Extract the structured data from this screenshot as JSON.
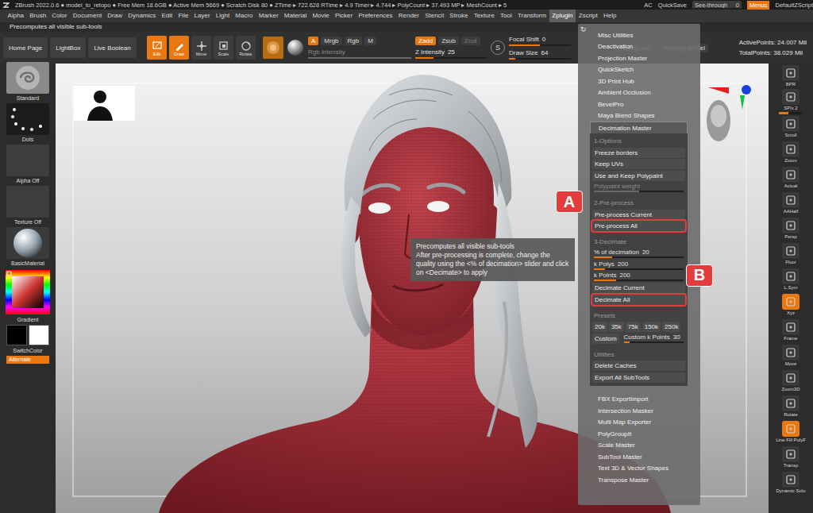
{
  "title_bar": {
    "info": "ZBrush 2022.0.6 ● model_to_retopo ● Free Mem 18.6GB ● Active Mem 5669 ● Scratch Disk 80 ● ZTime ▸ 722.628 RTime ▸ 4.9 Timer ▸ 4.744 ▸ PolyCount ▸ 37.493 MP ▸ MeshCount ▸ 5",
    "ac": "AC",
    "quicksave": "QuickSave",
    "see_through": {
      "label": "See-through",
      "value": "0",
      "level": 0
    },
    "menus": {
      "label": "Menus",
      "on": true
    },
    "script": "DefaultZScript"
  },
  "menu_bar": [
    {
      "label": "Alpha",
      "selected": false
    },
    {
      "label": "Brush",
      "selected": false
    },
    {
      "label": "Color",
      "selected": false
    },
    {
      "label": "Document",
      "selected": false
    },
    {
      "label": "Draw",
      "selected": false
    },
    {
      "label": "Dynamics",
      "selected": false
    },
    {
      "label": "Edit",
      "selected": false
    },
    {
      "label": "File",
      "selected": false
    },
    {
      "label": "Layer",
      "selected": false
    },
    {
      "label": "Light",
      "selected": false
    },
    {
      "label": "Macro",
      "selected": false
    },
    {
      "label": "Marker",
      "selected": false
    },
    {
      "label": "Material",
      "selected": false
    },
    {
      "label": "Movie",
      "selected": false
    },
    {
      "label": "Picker",
      "selected": false
    },
    {
      "label": "Preferences",
      "selected": false
    },
    {
      "label": "Render",
      "selected": false
    },
    {
      "label": "Stencil",
      "selected": false
    },
    {
      "label": "Stroke",
      "selected": false
    },
    {
      "label": "Texture",
      "selected": false
    },
    {
      "label": "Tool",
      "selected": false
    },
    {
      "label": "Transform",
      "selected": false
    },
    {
      "label": "Zplugin",
      "selected": true
    },
    {
      "label": "Zscript",
      "selected": false
    },
    {
      "label": "Help",
      "selected": false
    }
  ],
  "status": "Precomputes all visible sub-tools",
  "toolbar": {
    "nav": [
      {
        "label": "Home Page"
      },
      {
        "label": "LightBox"
      },
      {
        "label": "Live Boolean"
      }
    ],
    "modes": [
      {
        "label": "Edit",
        "on": true
      },
      {
        "label": "Draw",
        "on": true
      },
      {
        "label": "Move",
        "on": false
      },
      {
        "label": "Scale",
        "on": false
      },
      {
        "label": "Rotate",
        "on": false
      }
    ],
    "color_modes": [
      {
        "label": "A",
        "on": true
      },
      {
        "label": "Mrgb",
        "on": false
      },
      {
        "label": "Rgb",
        "on": false
      },
      {
        "label": "M",
        "on": false
      }
    ],
    "rgb_intensity": {
      "label": "Rgb Intensity",
      "level": 1,
      "disabled": true
    },
    "z_modes": [
      {
        "label": "Zadd",
        "on": true,
        "disabled": false
      },
      {
        "label": "Zsub",
        "on": false,
        "disabled": false
      },
      {
        "label": "Zcut",
        "on": false,
        "disabled": true
      }
    ],
    "z_intensity": {
      "label": "Z Intensity",
      "value": "25",
      "level": 0.25,
      "disabled": false
    },
    "stroke_icon": "S",
    "focal_shift": {
      "label": "Focal Shift",
      "value": "0",
      "level": 0.5,
      "disabled": false
    },
    "draw_size": {
      "label": "Draw Size",
      "value": "64",
      "level": 0.1,
      "disabled": false
    },
    "replay": [
      "ReplayLast",
      "ReplayLastRel"
    ],
    "points": [
      "ActivePoints: 24.007 Mil",
      "TotalPoints: 38.029 Mil"
    ]
  },
  "left_shelf": {
    "items": [
      {
        "label": "Standard",
        "kind": "brush"
      },
      {
        "label": "Dots",
        "kind": "stroke"
      },
      {
        "label": "Alpha Off",
        "kind": "alpha"
      },
      {
        "label": "Texture Off",
        "kind": "texture"
      },
      {
        "label": "BasicMaterial",
        "kind": "material"
      }
    ],
    "gradient": "Gradient",
    "main_color": "#000000",
    "secondary_color": "#ffffff",
    "switch_color": "SwitchColor",
    "alternate": {
      "label": "Alternate",
      "on": true
    }
  },
  "right_shelf": [
    {
      "label": "BPR",
      "kind": "icon",
      "on": false
    },
    {
      "label": "SPix 2",
      "kind": "slider",
      "on": false,
      "level": 0.4
    },
    {
      "label": "Scroll",
      "kind": "icon",
      "on": false
    },
    {
      "label": "Zoom",
      "kind": "icon",
      "on": false
    },
    {
      "label": "Actual",
      "kind": "icon",
      "on": false
    },
    {
      "label": "AAHalf",
      "kind": "icon",
      "on": false
    },
    {
      "label": "Persp",
      "kind": "icon",
      "on": false
    },
    {
      "label": "Floor",
      "kind": "icon",
      "on": false
    },
    {
      "label": "L.Sym",
      "kind": "icon",
      "on": false
    },
    {
      "label": "Xyz",
      "kind": "icon",
      "on": true
    },
    {
      "label": "Frame",
      "kind": "icon",
      "on": false
    },
    {
      "label": "Move",
      "kind": "icon",
      "on": false
    },
    {
      "label": "Zoom3D",
      "kind": "icon",
      "on": false
    },
    {
      "label": "Rotate",
      "kind": "icon",
      "on": false
    },
    {
      "label": "Line Fill PolyF",
      "kind": "icon",
      "on": true
    },
    {
      "label": "Transp",
      "kind": "icon",
      "on": false
    },
    {
      "label": "Dynamic Solo",
      "kind": "icon",
      "on": false
    }
  ],
  "zplugin_menu": {
    "top_icon": "↻",
    "items_before": [
      "Misc Utilities",
      "Deactivation",
      "Projection Master",
      "QuickSketch",
      "3D Print Hub",
      "Ambient Occlusion",
      "BevelPro",
      "Maya Blend Shapes"
    ],
    "decimation": {
      "title": "Decimation Master",
      "expanded": true,
      "sections": [
        {
          "heading": "1-Options",
          "rows": [
            {
              "kind": "button",
              "label": "Freeze borders"
            },
            {
              "kind": "button",
              "label": "Keep UVs"
            },
            {
              "kind": "button",
              "label": "Use and Keep Polypaint"
            },
            {
              "kind": "slider",
              "label": "Polypaint weight",
              "level": 0.5,
              "disabled": true
            }
          ]
        },
        {
          "heading": "2-Pre-process",
          "rows": [
            {
              "kind": "button",
              "label": "Pre-process Current"
            },
            {
              "kind": "button",
              "label": "Pre-process All",
              "callout": "A"
            }
          ]
        },
        {
          "heading": "3-Decimate",
          "rows": [
            {
              "kind": "slider",
              "label": "% of decimation",
              "value": "20",
              "level": 0.2,
              "disabled": false
            },
            {
              "kind": "slider",
              "label": "k Polys",
              "value": "200",
              "level": 0.12,
              "disabled": false
            },
            {
              "kind": "slider",
              "label": "k Points",
              "value": "200",
              "level": 0.25,
              "disabled": false
            },
            {
              "kind": "button",
              "label": "Decimate Current"
            },
            {
              "kind": "button",
              "label": "Decimate All",
              "callout": "B"
            }
          ]
        },
        {
          "heading": "Presets",
          "rows": [
            {
              "kind": "presets",
              "options": [
                "20k",
                "35k",
                "75k",
                "150k",
                "250k"
              ]
            },
            {
              "kind": "custom",
              "button": "Custom",
              "slider": {
                "label": "Custom k Points",
                "value": "30",
                "level": 0.1,
                "disabled": false
              }
            }
          ]
        },
        {
          "heading": "Utilities",
          "rows": [
            {
              "kind": "button",
              "label": "Delete Caches"
            },
            {
              "kind": "button",
              "label": "Export All SubTools"
            }
          ]
        }
      ]
    },
    "items_after": [
      "FBX ExportImport",
      "Intersection Masker",
      "Multi Map Exporter",
      "PolyGroupIt",
      "Scale Master",
      "SubTool Master",
      "Text 3D & Vector Shapes",
      "Transpose Master"
    ]
  },
  "tooltip": {
    "title": "Precomputes all visible sub-tools",
    "body": "After pre-processing is complete, change the quality using the <% of decimation> slider and click on <Decimate> to apply"
  }
}
